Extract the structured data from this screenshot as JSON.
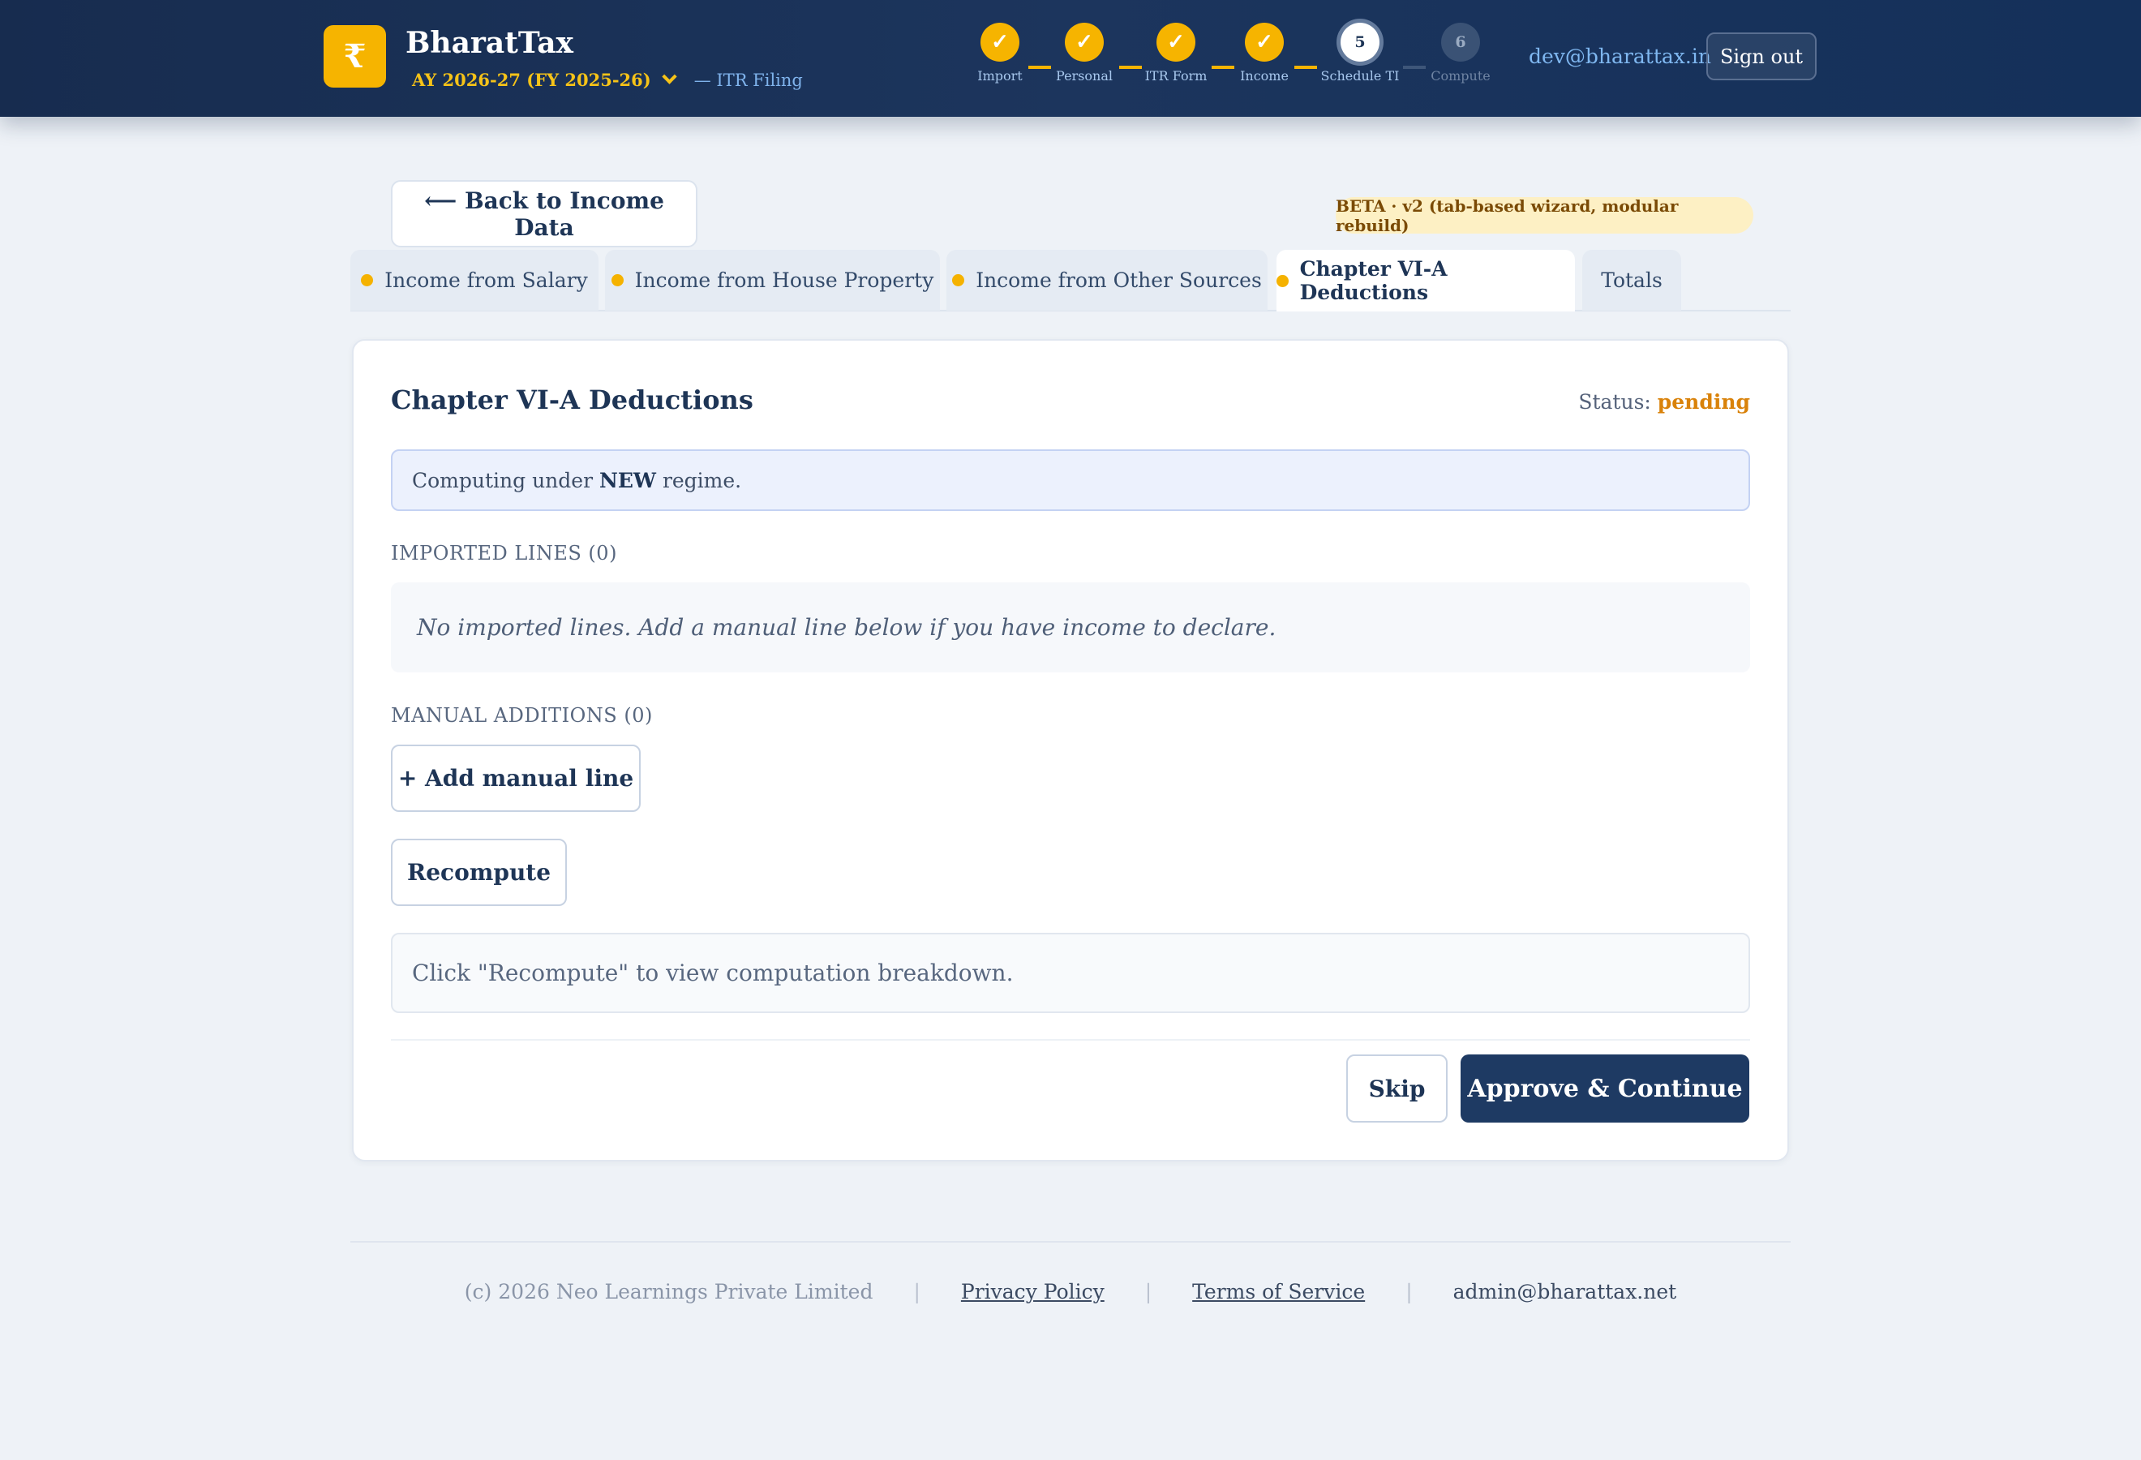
{
  "header": {
    "logo_glyph": "₹",
    "brand": "BharatTax",
    "assessment_year": "AY 2026-27 (FY 2025-26)",
    "subtitle": "— ITR Filing",
    "user_email": "dev@bharattax.in",
    "signout_label": "Sign out",
    "steps": [
      {
        "label": "Import",
        "state": "done",
        "marker": "✓"
      },
      {
        "label": "Personal",
        "state": "done",
        "marker": "✓"
      },
      {
        "label": "ITR Form",
        "state": "done",
        "marker": "✓"
      },
      {
        "label": "Income",
        "state": "done",
        "marker": "✓"
      },
      {
        "label": "Schedule TI",
        "state": "active",
        "marker": "5"
      },
      {
        "label": "Compute",
        "state": "todo",
        "marker": "6"
      }
    ]
  },
  "back_label": "⟵ Back to Income Data",
  "beta_badge": "BETA · v2 (tab-based wizard, modular rebuild)",
  "tabs": [
    {
      "label": "Income from Salary",
      "dot": true
    },
    {
      "label": "Income from House Property",
      "dot": true
    },
    {
      "label": "Income from Other Sources",
      "dot": true
    },
    {
      "label": "Chapter VI-A Deductions",
      "dot": true,
      "active": true
    },
    {
      "label": "Totals",
      "dot": false
    }
  ],
  "card": {
    "title": "Chapter VI-A Deductions",
    "status_label": "Status:",
    "status_value": "pending",
    "regime_prefix": "Computing under",
    "regime_value": "NEW",
    "regime_suffix": "regime.",
    "imported_heading": "IMPORTED LINES (0)",
    "imported_empty": "No imported lines. Add a manual line below if you have income to declare.",
    "manual_heading": "MANUAL ADDITIONS (0)",
    "add_line_label": "+ Add manual line",
    "recompute_label": "Recompute",
    "breakdown_hint": "Click \"Recompute\" to view computation breakdown.",
    "skip_label": "Skip",
    "approve_label": "Approve & Continue"
  },
  "footer": {
    "copyright": "(c) 2026 Neo Learnings Private Limited",
    "privacy": "Privacy Policy",
    "terms": "Terms of Service",
    "contact": "admin@bharattax.net",
    "separator": "|"
  },
  "colors": {
    "header_bg": "#1c355d",
    "accent_gold": "#f6b400",
    "primary_navy": "#1e3a63",
    "status_pending": "#d9820a",
    "page_bg": "#eef2f7"
  }
}
